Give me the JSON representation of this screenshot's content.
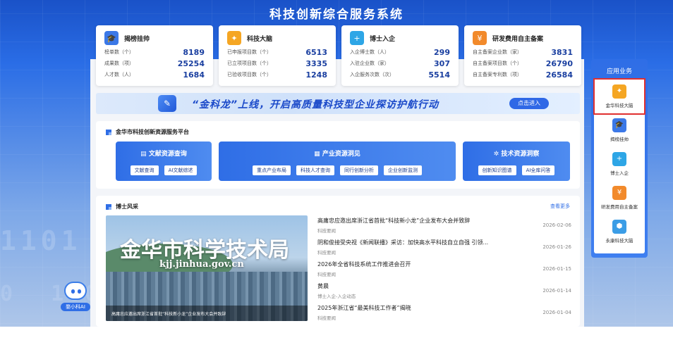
{
  "header": {
    "title": "科技创新综合服务系统"
  },
  "stat_cards": [
    {
      "title": "揭榜挂帅",
      "icon": "graduation-cap-icon",
      "color": "#3b78e7",
      "rows": [
        {
          "label": "榜单数（个）",
          "value": "8189"
        },
        {
          "label": "成果数（项）",
          "value": "25254"
        },
        {
          "label": "人才数（人）",
          "value": "1684"
        }
      ]
    },
    {
      "title": "科技大脑",
      "icon": "brain-icon",
      "color": "#f5a623",
      "rows": [
        {
          "label": "已申报项目数（个）",
          "value": "6513"
        },
        {
          "label": "已立项项目数（个）",
          "value": "3335"
        },
        {
          "label": "已验收项目数（个）",
          "value": "1248"
        }
      ]
    },
    {
      "title": "博士入企",
      "icon": "doctor-plus-icon",
      "color": "#2ea6e6",
      "rows": [
        {
          "label": "入企博士数（人）",
          "value": "299"
        },
        {
          "label": "入驻企业数（家）",
          "value": "307"
        },
        {
          "label": "入企服务次数（次）",
          "value": "5514"
        }
      ]
    },
    {
      "title": "研发费用自主备案",
      "icon": "document-fee-icon",
      "color": "#f28a2b",
      "rows": [
        {
          "label": "自主备案企业数（家）",
          "value": "3831"
        },
        {
          "label": "自主备案项目数（个）",
          "value": "26790"
        },
        {
          "label": "自主备案专利数（项）",
          "value": "26584"
        }
      ]
    }
  ],
  "banner": {
    "text": "“金科龙”上线，开启高质量科技型企业探访护航行动",
    "button": "点击进入"
  },
  "platform": {
    "title": "金华市科技创新资源服务平台",
    "sections": [
      {
        "title": "文献资源查询",
        "buttons": [
          "文献查询",
          "AI文献综述"
        ]
      },
      {
        "title": "产业资源洞见",
        "buttons": [
          "重点产业布局",
          "科技人才查询",
          "同行创新分析",
          "企业创新监测"
        ]
      },
      {
        "title": "技术资源洞察",
        "buttons": [
          "创新知识图谱",
          "AI全库问答"
        ]
      }
    ]
  },
  "news": {
    "title": "博士风采",
    "more": "查看更多",
    "photo": {
      "title": "金华市科学技术局",
      "url": "kjj.jinhua.gov.cn",
      "caption": "高庸忠应邀出席浙江省首批“科技新小龙”企业发布大会并致辞"
    },
    "items": [
      {
        "headline": "高庸忠应邀出席浙江省首批“科技新小龙”企业发布大会并致辞",
        "source": "科技要闻",
        "date": "2026-02-06"
      },
      {
        "headline": "阴和俊接受央视《新闻联播》采访：加快高水平科技自立自强 引领...",
        "source": "科技要闻",
        "date": "2026-01-26"
      },
      {
        "headline": "2026年全省科技系统工作推进会召开",
        "source": "科技要闻",
        "date": "2026-01-15"
      },
      {
        "headline": "黄晨",
        "source": "博士入企-入企动态",
        "date": "2026-01-14"
      },
      {
        "headline": "2025年浙江省“最美科技工作者”揭晓",
        "source": "科技要闻",
        "date": "2026-01-04"
      }
    ]
  },
  "apps": {
    "title": "应用业务",
    "items": [
      {
        "label": "金华科技大脑",
        "icon": "brain-icon",
        "color": "#f5a623"
      },
      {
        "label": "揭榜挂帅",
        "icon": "graduation-cap-icon",
        "color": "#3b78e7"
      },
      {
        "label": "博士入企",
        "icon": "doctor-plus-icon",
        "color": "#2ea6e6"
      },
      {
        "label": "研发费用自主备案",
        "icon": "document-fee-icon",
        "color": "#f28a2b"
      },
      {
        "label": "永康科技大脑",
        "icon": "hexagon-icon",
        "color": "#3b9de6"
      }
    ]
  },
  "assistant": {
    "label": "婺小科AI"
  }
}
